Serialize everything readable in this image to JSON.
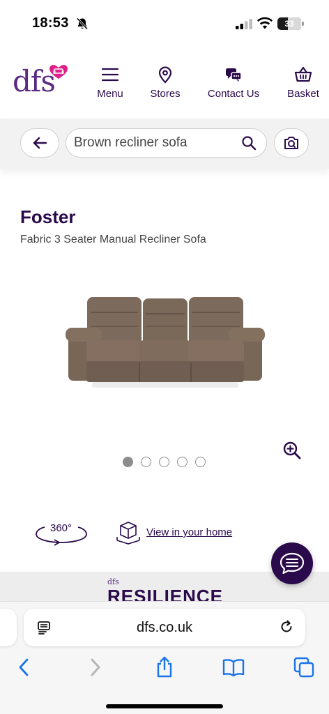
{
  "status_bar": {
    "time": "18:53",
    "battery_level": "33",
    "icons": [
      "bell-slash-icon",
      "cellular-signal-icon",
      "wifi-icon",
      "battery-icon"
    ]
  },
  "header": {
    "logo_text": "dfs",
    "nav": [
      {
        "label": "Menu",
        "icon": "hamburger-menu-icon"
      },
      {
        "label": "Stores",
        "icon": "location-pin-icon"
      },
      {
        "label": "Contact Us",
        "icon": "chat-bubbles-icon"
      },
      {
        "label": "Basket",
        "icon": "basket-icon"
      }
    ]
  },
  "search": {
    "value": "Brown recliner sofa",
    "back_icon": "arrow-left-icon",
    "search_icon": "magnifier-icon",
    "camera_icon": "camera-search-icon"
  },
  "product": {
    "name": "Foster",
    "subtitle": "Fabric 3 Seater Manual Recliner Sofa",
    "image_icon": "sofa-image",
    "gallery_dots": 5,
    "active_dot": 1,
    "zoom_icon": "zoom-in-icon"
  },
  "features": {
    "view_360_label": "360°",
    "view_home_label": "View in your home"
  },
  "banner": {
    "brand_small": "dfs",
    "title": "RESILIENCE"
  },
  "safari": {
    "url": "dfs.co.uk",
    "toolbar_icons": [
      "back-chevron-icon",
      "forward-chevron-icon",
      "share-icon",
      "bookmarks-icon",
      "tabs-icon"
    ]
  },
  "colors": {
    "brand_purple": "#5b2a82",
    "brand_pink": "#e0208a",
    "nav_text": "#2a0a4a",
    "safari_blue": "#1a73e8",
    "sofa_brown": "#7c6a5c"
  }
}
